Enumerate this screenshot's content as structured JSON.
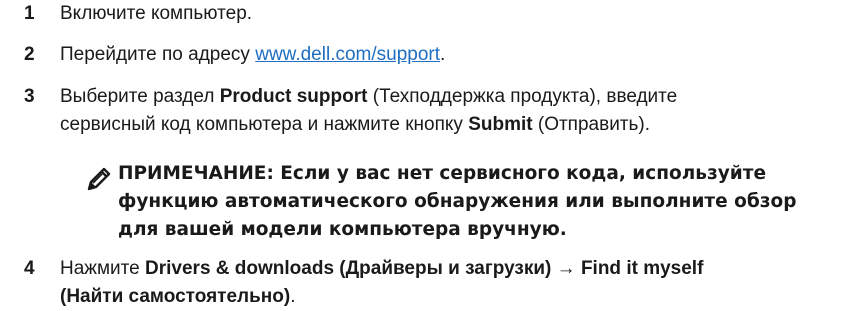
{
  "steps": [
    {
      "number": "1",
      "text": "Включите компьютер."
    },
    {
      "number": "2",
      "pre": "Перейдите по адресу ",
      "link": "www.dell.com/support",
      "post": "."
    },
    {
      "number": "3",
      "pre": "Выберите раздел ",
      "bold1": "Product support",
      "mid": " (Техподдержка продукта), введите",
      "line2_pre": "сервисный код компьютера и нажмите кнопку ",
      "bold2": "Submit",
      "post": " (Отправить)."
    },
    {
      "number": "4",
      "pre": "Нажмите ",
      "bold1": "Drivers & downloads (Драйверы и загрузки)",
      "arrow": " → ",
      "bold2": "Find it myself",
      "line2_bold": "(Найти самостоятельно)",
      "post": "."
    }
  ],
  "note": {
    "line1": "ПРИМЕЧАНИЕ: Если у вас нет сервисного кода, используйте",
    "line2": "функцию автоматического обнаружения или выполните обзор",
    "line3": "для вашей модели компьютера вручную.",
    "icon": "pencil-note-icon"
  },
  "colors": {
    "text": "#1a1a1a",
    "link": "#1f6ec1"
  }
}
